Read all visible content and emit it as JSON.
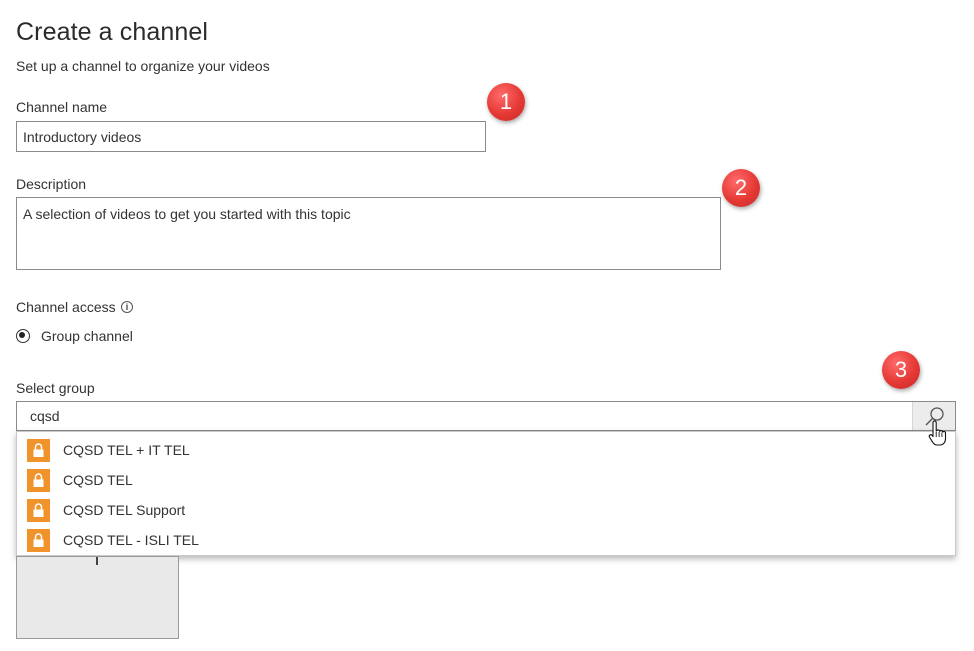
{
  "header": {
    "title": "Create a channel",
    "subtitle": "Set up a channel to organize your videos"
  },
  "channel_name": {
    "label": "Channel name",
    "value": "Introductory videos"
  },
  "description": {
    "label": "Description",
    "value": "A selection of videos to get you started with this topic"
  },
  "channel_access": {
    "label": "Channel access",
    "info_icon": "i",
    "option_label": "Group channel"
  },
  "select_group": {
    "label": "Select group",
    "value": "cqsd",
    "results": [
      "CQSD TEL + IT TEL",
      "CQSD TEL",
      "CQSD TEL Support",
      "CQSD TEL - ISLI TEL"
    ]
  },
  "annotations": [
    "1",
    "2",
    "3"
  ],
  "colors": {
    "lock_badge": "#f0932b",
    "step_badge": "#e53935",
    "thumb_bg": "#e9e9e9"
  },
  "icons": {
    "search": "search-icon",
    "lock": "lock-icon",
    "cursor": "hand-pointer-icon",
    "info": "info-icon"
  }
}
